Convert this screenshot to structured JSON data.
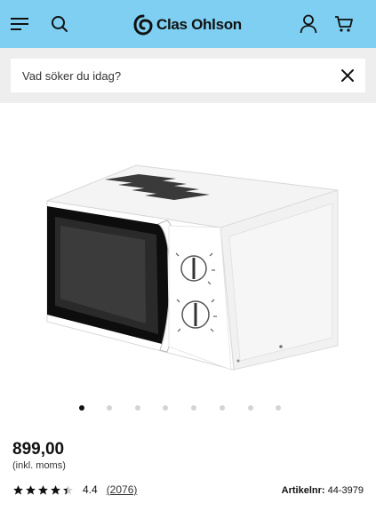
{
  "header": {
    "brand": "Clas Ohlson",
    "background": "#7ecff1",
    "icons": [
      "menu-icon",
      "search-icon",
      "account-icon",
      "cart-icon"
    ]
  },
  "search": {
    "placeholder": "Vad söker du idag?",
    "value": ""
  },
  "gallery": {
    "image_count": 8,
    "active_index": 0
  },
  "product": {
    "price": "899,00",
    "price_note": "(inkl. moms)",
    "rating": 4.4,
    "rating_display": "4.4",
    "review_count": "(2076)",
    "article_label": "Artikelnr:",
    "article_number": "44-3979"
  },
  "colors": {
    "accent": "#7ecff1",
    "text": "#111111",
    "search_band": "#eeeeee"
  }
}
